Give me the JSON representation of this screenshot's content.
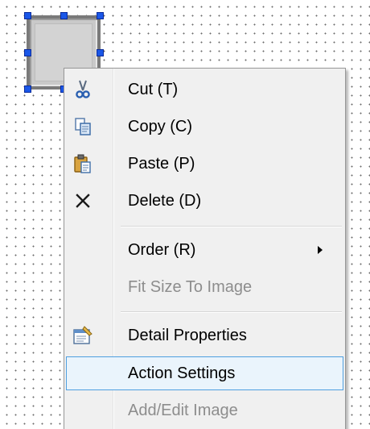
{
  "canvas": {
    "grid": true
  },
  "context_menu": {
    "items": [
      {
        "label": "Cut (T)",
        "icon": "scissors-icon",
        "enabled": true
      },
      {
        "label": "Copy (C)",
        "icon": "copy-icon",
        "enabled": true
      },
      {
        "label": "Paste (P)",
        "icon": "paste-icon",
        "enabled": true
      },
      {
        "label": "Delete (D)",
        "icon": "delete-x-icon",
        "enabled": true
      },
      {
        "label": "Order (R)",
        "icon": "",
        "enabled": true,
        "submenu": true
      },
      {
        "label": "Fit Size To Image",
        "icon": "",
        "enabled": false
      },
      {
        "label": "Detail Properties",
        "icon": "properties-icon",
        "enabled": true
      },
      {
        "label": "Action Settings",
        "icon": "",
        "enabled": true,
        "highlighted": true
      },
      {
        "label": "Add/Edit Image",
        "icon": "",
        "enabled": false
      }
    ]
  },
  "colors": {
    "selection_handle": "#1a57e8",
    "menu_background": "#f0f0f0",
    "highlight_border": "#4f9fe0",
    "highlight_fill": "#eaf4fc",
    "disabled_text": "#8d8d8d"
  }
}
